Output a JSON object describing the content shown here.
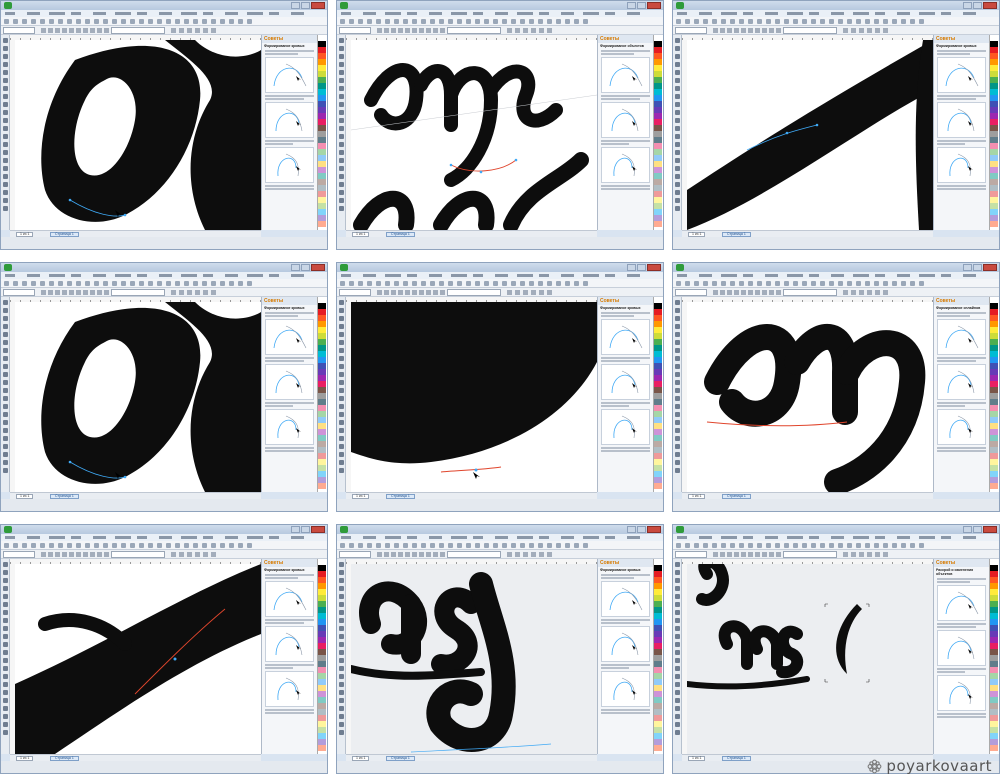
{
  "watermark": {
    "text": "poyarkovaart",
    "icon": "flower-logo-icon"
  },
  "docker_title": "Советы",
  "page_tab": "Страница 1",
  "page_counter": "1 из 1",
  "windows": [
    {
      "id": "w1",
      "docker_heading": "Формирование кривых",
      "scene": "loop-left",
      "canvas": "white"
    },
    {
      "id": "w2",
      "docker_heading": "Формирование объектов",
      "scene": "word-ans",
      "canvas": "white"
    },
    {
      "id": "w3",
      "docker_heading": "Формирование кривых",
      "scene": "diagonal",
      "canvas": "white"
    },
    {
      "id": "w4",
      "docker_heading": "Формирование кривых",
      "scene": "loop-left",
      "canvas": "white"
    },
    {
      "id": "w5",
      "docker_heading": "Формирование кривых",
      "scene": "bowl",
      "canvas": "white"
    },
    {
      "id": "w6",
      "docker_heading": "Формирование сплайнов",
      "scene": "word-ans-zoom",
      "canvas": "white"
    },
    {
      "id": "w7",
      "docker_heading": "Формирование кривых",
      "scene": "diagonal-stroke",
      "canvas": "white"
    },
    {
      "id": "w8",
      "docker_heading": "Формирование кривых",
      "scene": "word-ds",
      "canvas": "grey"
    },
    {
      "id": "w9",
      "docker_heading": "Раскрой и изменения объектов",
      "scene": "word-ads",
      "canvas": "grey"
    }
  ]
}
